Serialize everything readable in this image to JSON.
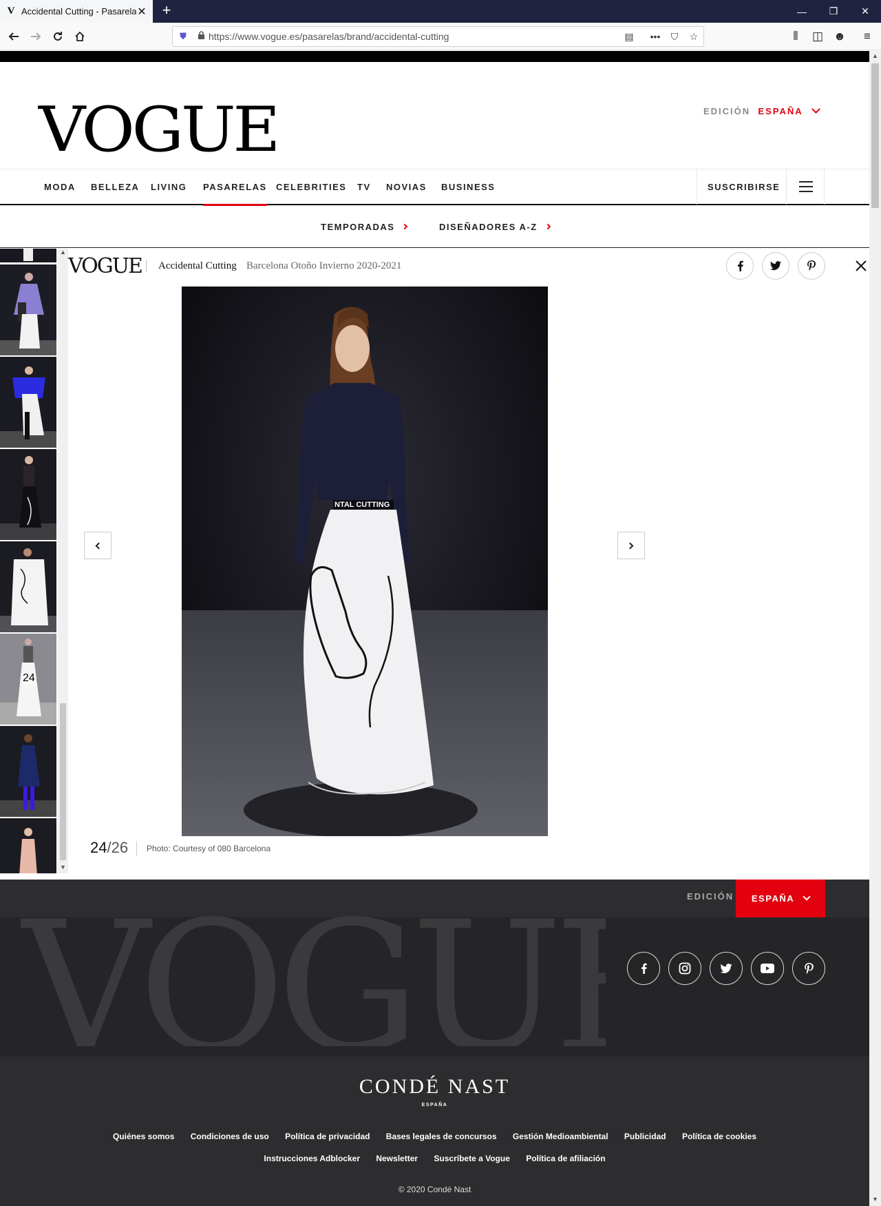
{
  "browser": {
    "tab_title": "Accidental Cutting - Pasarelas | Vogue",
    "favicon": "V",
    "url": "https://www.vogue.es/pasarelas/brand/accidental-cutting"
  },
  "header": {
    "logo": "VOGUE",
    "edition_label": "EDICIÓN",
    "edition_value": "ESPAÑA"
  },
  "nav": {
    "items": [
      "MODA",
      "BELLEZA",
      "LIVING",
      "PASARELAS",
      "CELEBRITIES",
      "TV",
      "NOVIAS",
      "BUSINESS"
    ],
    "active": "PASARELAS",
    "subscribe": "SUSCRIBIRSE"
  },
  "subnav": {
    "items": [
      "TEMPORADAS",
      "DISEÑADORES A-Z"
    ]
  },
  "gallery": {
    "logo": "VOGUE",
    "brand": "Accidental Cutting",
    "season": "Barcelona Otoño Invierno 2020-2021",
    "current": "24",
    "separator": "/",
    "total": "26",
    "credit": "Photo: Courtesy of 080 Barcelona",
    "thumb_active_number": "24",
    "belt_text": "NTAL CUTTING"
  },
  "footer": {
    "edition_label": "EDICIÓN",
    "edition_value": "ESPAÑA",
    "watermark": "VOGUE",
    "publisher": "CONDÉ NAST",
    "publisher_sub": "ESPAÑA",
    "links_row1": [
      "Quiénes somos",
      "Condiciones de uso",
      "Política de privacidad",
      "Bases legales de concursos",
      "Gestión Medioambiental",
      "Publicidad",
      "Política de cookies"
    ],
    "links_row2": [
      "Instrucciones Adblocker",
      "Newsletter",
      "Suscríbete a Vogue",
      "Política de afiliación"
    ],
    "copyright": "© 2020 Condé Nast"
  },
  "colors": {
    "accent": "#e3000f",
    "footer_bg": "#2d2d2f"
  }
}
